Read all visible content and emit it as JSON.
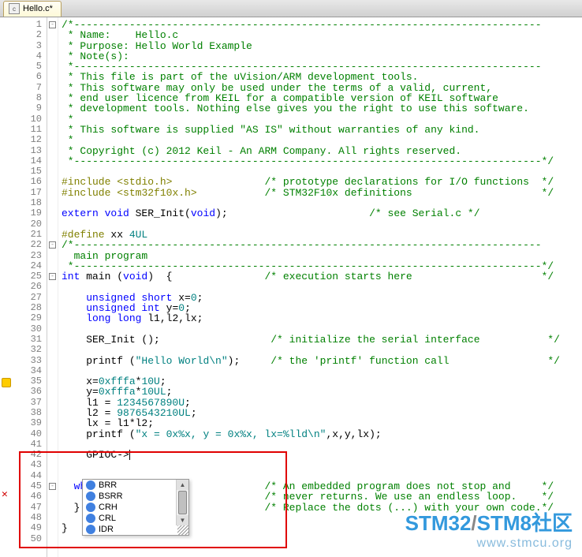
{
  "tab": {
    "label": "Hello.c*"
  },
  "autocomplete": {
    "items": [
      "BRR",
      "BSRR",
      "CRH",
      "CRL",
      "IDR"
    ]
  },
  "watermark": {
    "line1a": "STM32",
    "line1b": "/",
    "line1c": "STM8社区",
    "line2": "www.stmcu.org"
  },
  "lines": [
    {
      "n": 1,
      "html": "<span class='c-com'>/*----------------------------------------------------------------------------</span>"
    },
    {
      "n": 2,
      "html": "<span class='c-com'> * Name:    Hello.c</span>"
    },
    {
      "n": 3,
      "html": "<span class='c-com'> * Purpose: Hello World Example</span>"
    },
    {
      "n": 4,
      "html": "<span class='c-com'> * Note(s):</span>"
    },
    {
      "n": 5,
      "html": "<span class='c-com'> *----------------------------------------------------------------------------</span>"
    },
    {
      "n": 6,
      "html": "<span class='c-com'> * This file is part of the uVision/ARM development tools.</span>"
    },
    {
      "n": 7,
      "html": "<span class='c-com'> * This software may only be used under the terms of a valid, current,</span>"
    },
    {
      "n": 8,
      "html": "<span class='c-com'> * end user licence from KEIL for a compatible version of KEIL software</span>"
    },
    {
      "n": 9,
      "html": "<span class='c-com'> * development tools. Nothing else gives you the right to use this software.</span>"
    },
    {
      "n": 10,
      "html": "<span class='c-com'> *</span>"
    },
    {
      "n": 11,
      "html": "<span class='c-com'> * This software is supplied \"AS IS\" without warranties of any kind.</span>"
    },
    {
      "n": 12,
      "html": "<span class='c-com'> *</span>"
    },
    {
      "n": 13,
      "html": "<span class='c-com'> * Copyright (c) 2012 Keil - An ARM Company. All rights reserved.</span>"
    },
    {
      "n": 14,
      "html": "<span class='c-com'> *----------------------------------------------------------------------------*/</span>"
    },
    {
      "n": 15,
      "html": ""
    },
    {
      "n": 16,
      "html": "<span class='c-pp'>#include</span> <span class='c-inc'>&lt;stdio.h&gt;</span>               <span class='c-com'>/* prototype declarations for I/O functions  */</span>"
    },
    {
      "n": 17,
      "html": "<span class='c-pp'>#include</span> <span class='c-inc'>&lt;stm32f10x.h&gt;</span>           <span class='c-com'>/* STM32F10x definitions                     */</span>"
    },
    {
      "n": 18,
      "html": ""
    },
    {
      "n": 19,
      "html": "<span class='c-kw'>extern void</span> SER_Init(<span class='c-kw'>void</span>);                       <span class='c-com'>/* see Serial.c */</span>"
    },
    {
      "n": 20,
      "html": ""
    },
    {
      "n": 21,
      "html": "<span class='c-pp'>#define</span> xx <span class='c-num'>4UL</span>"
    },
    {
      "n": 22,
      "html": "<span class='c-com'>/*----------------------------------------------------------------------------</span>"
    },
    {
      "n": 23,
      "html": "<span class='c-com'>  main program</span>"
    },
    {
      "n": 24,
      "html": "<span class='c-com'> *----------------------------------------------------------------------------*/</span>"
    },
    {
      "n": 25,
      "html": "<span class='c-kw'>int</span> main (<span class='c-kw'>void</span>)  {               <span class='c-com'>/* execution starts here                     */</span>"
    },
    {
      "n": 26,
      "html": ""
    },
    {
      "n": 27,
      "html": "    <span class='c-kw'>unsigned short</span> x=<span class='c-num'>0</span>;"
    },
    {
      "n": 28,
      "html": "    <span class='c-kw'>unsigned int</span> y=<span class='c-num'>0</span>;"
    },
    {
      "n": 29,
      "html": "    <span class='c-kw'>long long</span> l1,l2,lx;"
    },
    {
      "n": 30,
      "html": ""
    },
    {
      "n": 31,
      "html": "    SER_Init ();                  <span class='c-com'>/* initialize the serial interface           */</span>"
    },
    {
      "n": 32,
      "html": ""
    },
    {
      "n": 33,
      "html": "    printf (<span class='c-str'>\"Hello World\\n\"</span>);     <span class='c-com'>/* the 'printf' function call                */</span>"
    },
    {
      "n": 34,
      "html": ""
    },
    {
      "n": 35,
      "html": "    x=<span class='c-num'>0xfffa</span>*<span class='c-num'>10U</span>;"
    },
    {
      "n": 36,
      "html": "    y=<span class='c-num'>0xfffa</span>*<span class='c-num'>10UL</span>;"
    },
    {
      "n": 37,
      "html": "    l1 = <span class='c-num'>1234567890U</span>;"
    },
    {
      "n": 38,
      "html": "    l2 = <span class='c-num'>9876543210UL</span>;"
    },
    {
      "n": 39,
      "html": "    lx = l1*l2;"
    },
    {
      "n": 40,
      "html": "    printf (<span class='c-str'>\"x = 0x%x, y = 0x%x, lx=%lld\\n\"</span>,x,y,lx);"
    },
    {
      "n": 41,
      "html": ""
    },
    {
      "n": 42,
      "html": "    GPIOC-&gt;<span class='cursor'></span>",
      "hl": true
    },
    {
      "n": 43,
      "html": ""
    },
    {
      "n": 44,
      "html": ""
    },
    {
      "n": 45,
      "html": "  <span class='c-kw'>while</span> (                        <span class='c-com'>/* An embedded program does not stop and     */</span>"
    },
    {
      "n": 46,
      "html": "    ;                            <span class='c-com'>/* never returns. We use an endless loop.    */</span>"
    },
    {
      "n": 47,
      "html": "  }                              <span class='c-com'>/* Replace the dots (...) with your own code.*/</span>"
    },
    {
      "n": 48,
      "html": ""
    },
    {
      "n": 49,
      "html": "}"
    },
    {
      "n": 50,
      "html": ""
    }
  ]
}
